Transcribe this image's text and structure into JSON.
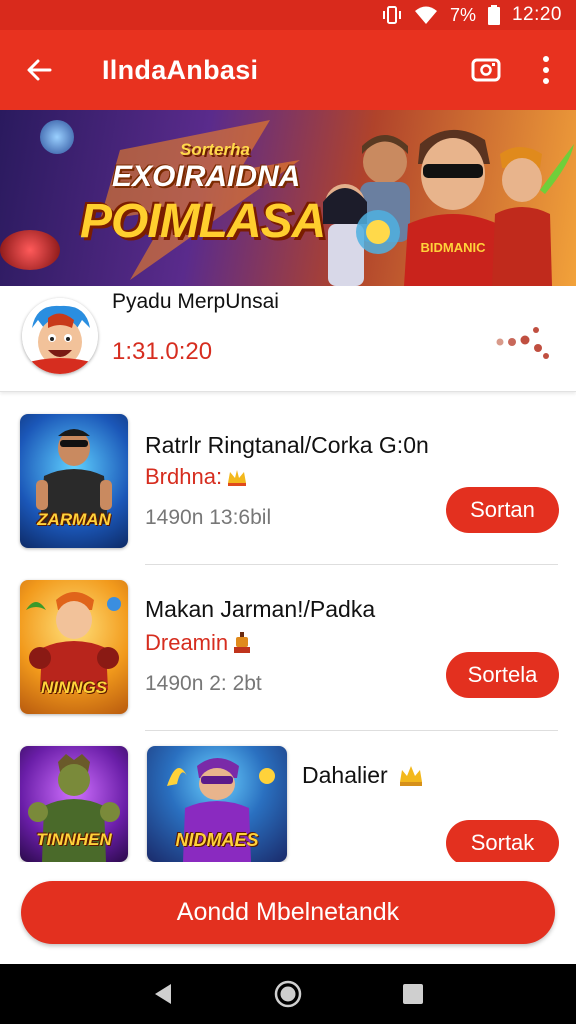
{
  "status_bar": {
    "battery_text": "7%",
    "time": "12:20",
    "icons": [
      "vibrate-icon",
      "wifi-icon",
      "battery-icon"
    ]
  },
  "app_bar": {
    "title": "IlndaAnbasi",
    "icons": [
      "back-arrow-icon",
      "screenshot-icon",
      "more-vert-icon"
    ]
  },
  "banner": {
    "small_text": "Sorterha",
    "mid_text": "EXOIRAIDNA",
    "big_text": "POIMLASA",
    "shirt_text": "BIDMANIC"
  },
  "profile": {
    "name": "Pyadu MerpUnsai",
    "score": "1:31.0:20"
  },
  "games": [
    {
      "title": "Ratrlr Ringtanal/Corka  G:0n",
      "subtitle": "Brdhna:",
      "meta": "1490n 13:6bil",
      "cta": "Sortan",
      "thumb_label": "ZARMAN",
      "badge_icon": "crown-icon"
    },
    {
      "title": "Makan Jarman!/Padka",
      "subtitle": "Dreamin",
      "meta": "1490n 2: 2bt",
      "cta": "Sortela",
      "thumb_label": "NINNGS",
      "badge_icon": "trophy-icon"
    },
    {
      "title": "Dahalier",
      "subtitle": "",
      "meta": "",
      "cta": "Sortak",
      "thumb_label": "TINNHEN",
      "thumb2_label": "NIDMAES",
      "badge_icon": "crown-icon"
    }
  ],
  "bottom_button": {
    "label": "Aondd Mbelnetandk"
  },
  "nav_bar": {
    "icons": [
      "back-triangle-icon",
      "home-circle-icon",
      "recents-square-icon"
    ]
  },
  "colors": {
    "brand_red": "#e8321f",
    "status_red": "#d92a1c",
    "accent_text_red": "#d62d1f"
  }
}
